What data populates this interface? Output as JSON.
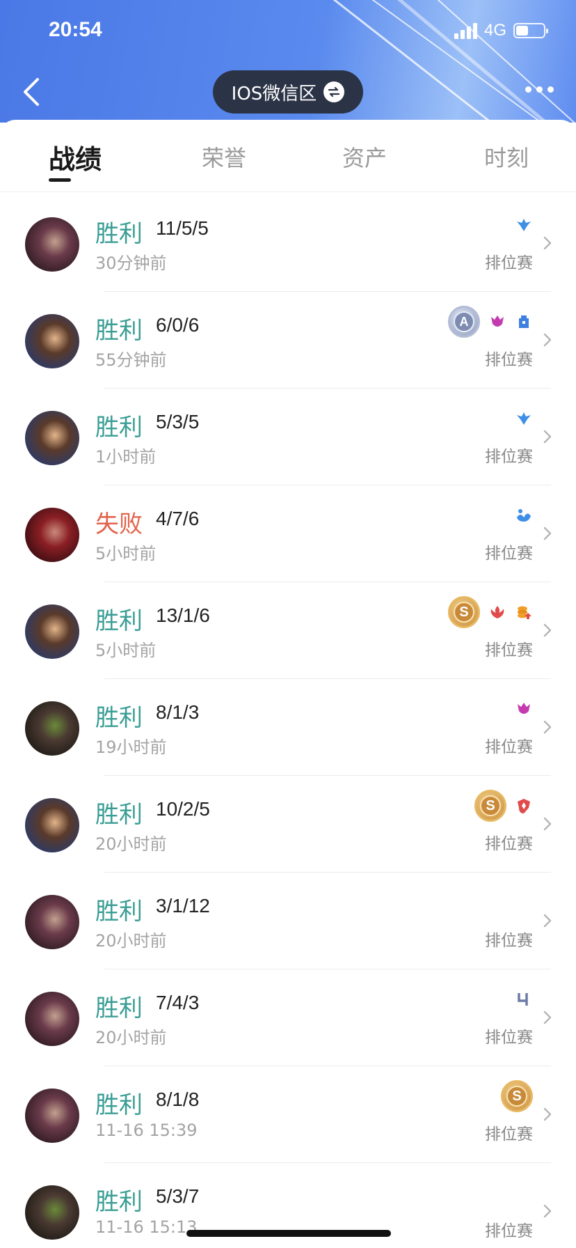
{
  "status_bar": {
    "time": "20:54",
    "network": "4G"
  },
  "header": {
    "region": "IOS微信区"
  },
  "tabs": [
    {
      "label": "战绩",
      "active": true
    },
    {
      "label": "荣誉",
      "active": false
    },
    {
      "label": "资产",
      "active": false
    },
    {
      "label": "时刻",
      "active": false
    }
  ],
  "colors": {
    "win": "#3a9e95",
    "lose": "#e2634c",
    "header_blue": "#4a78e6"
  },
  "matches": [
    {
      "result": "胜利",
      "kda": "11/5/5",
      "time": "30分钟前",
      "mode": "排位赛",
      "badges": [
        "mvp-blue-icon"
      ]
    },
    {
      "result": "胜利",
      "kda": "6/0/6",
      "time": "55分钟前",
      "mode": "排位赛",
      "medal": "A",
      "badges": [
        "demon-pink-icon",
        "tower-blue-icon"
      ]
    },
    {
      "result": "胜利",
      "kda": "5/3/5",
      "time": "1小时前",
      "mode": "排位赛",
      "badges": [
        "mvp-blue-icon"
      ]
    },
    {
      "result": "失败",
      "kda": "4/7/6",
      "time": "5小时前",
      "mode": "排位赛",
      "badges": [
        "lotus-blue-icon"
      ]
    },
    {
      "result": "胜利",
      "kda": "13/1/6",
      "time": "5小时前",
      "mode": "排位赛",
      "medal": "S",
      "badges": [
        "flame-red-icon",
        "coins-orange-icon"
      ]
    },
    {
      "result": "胜利",
      "kda": "8/1/3",
      "time": "19小时前",
      "mode": "排位赛",
      "badges": [
        "demon-pink-icon"
      ]
    },
    {
      "result": "胜利",
      "kda": "10/2/5",
      "time": "20小时前",
      "mode": "排位赛",
      "medal": "S",
      "badges": [
        "shield-red-icon"
      ]
    },
    {
      "result": "胜利",
      "kda": "3/1/12",
      "time": "20小时前",
      "mode": "排位赛",
      "badges": []
    },
    {
      "result": "胜利",
      "kda": "7/4/3",
      "time": "20小时前",
      "mode": "排位赛",
      "badges": [
        "quadra-kill-icon"
      ]
    },
    {
      "result": "胜利",
      "kda": "8/1/8",
      "time": "11-16 15:39",
      "mode": "排位赛",
      "medal": "S",
      "badges": []
    },
    {
      "result": "胜利",
      "kda": "5/3/7",
      "time": "11-16 15:13",
      "mode": "排位赛",
      "badges": []
    }
  ]
}
